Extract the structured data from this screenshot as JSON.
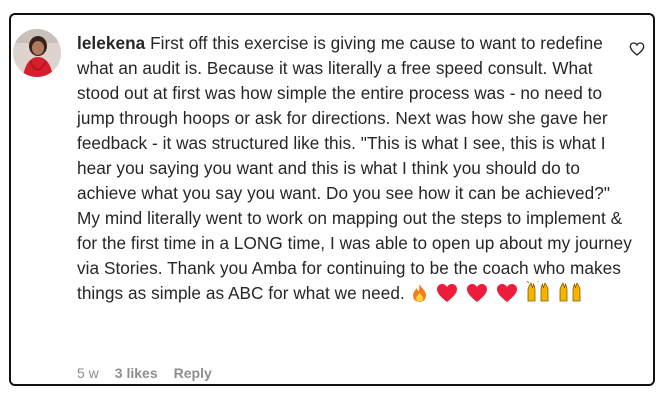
{
  "comment": {
    "username": "lelekena",
    "text": "First off this exercise is giving me cause to want to redefine what an audit is. Because it was literally a free speed consult. What stood out at first was how simple the entire process was - no need to jump through hoops or ask for directions. Next was how she gave her feedback - it was structured like this. \"This is what I see, this is what I hear you saying you want and this is what I think you should do to achieve what you say you want. Do you see how it can be achieved?\" My mind literally went to work on mapping out the steps to implement & for the first time in a LONG time, I was able to open up about my journey via Stories. Thank you Amba for continuing to be the coach who makes things as simple as ABC for what we need.",
    "emojis": [
      "fire-emoji",
      "red-heart-emoji",
      "red-heart-emoji",
      "red-heart-emoji",
      "raising-hands-emoji",
      "raising-hands-emoji"
    ]
  },
  "meta": {
    "age": "5 w",
    "likes": "3 likes",
    "reply": "Reply"
  },
  "colors": {
    "text": "#262626",
    "muted": "#8e8e8e",
    "heart": "#ed1c3a",
    "hands": "#f5b400"
  }
}
